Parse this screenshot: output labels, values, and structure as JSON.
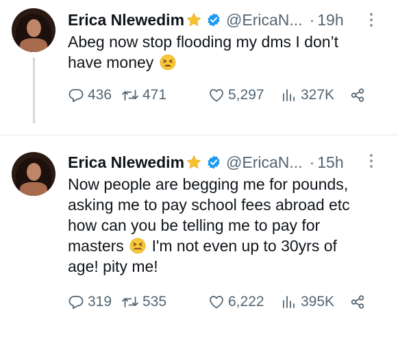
{
  "tweets": [
    {
      "author": {
        "name": "Erica Nlewedim",
        "badge_emoji": "star-icon",
        "verified": "verified-badge-icon",
        "handle": "@EricaN...",
        "separator": "·",
        "time": "19h"
      },
      "text_lines": [
        "Abeg now stop flooding my dms I don’t",
        "have money"
      ],
      "text_emoji": "tired-face-emoji",
      "stats": {
        "replies": "436",
        "retweets": "471",
        "likes": "5,297",
        "views": "327K"
      }
    },
    {
      "author": {
        "name": "Erica Nlewedim",
        "badge_emoji": "star-icon",
        "verified": "verified-badge-icon",
        "handle": "@EricaN...",
        "separator": "·",
        "time": "15h"
      },
      "text_lines": [
        "Now people are begging me for  pounds,",
        "asking me to pay school fees abroad etc",
        "how can you be telling me to pay for",
        "masters",
        "I'm not even up to 30yrs of",
        "age! pity me!"
      ],
      "text_emoji": "confounded-face-emoji",
      "stats": {
        "replies": "319",
        "retweets": "535",
        "likes": "6,222",
        "views": "395K"
      }
    }
  ],
  "colors": {
    "text": "#0f1419",
    "secondary": "#536471",
    "verified": "#1d9bf0",
    "star": "#f7c22f",
    "thread_line": "#cfd9de"
  }
}
